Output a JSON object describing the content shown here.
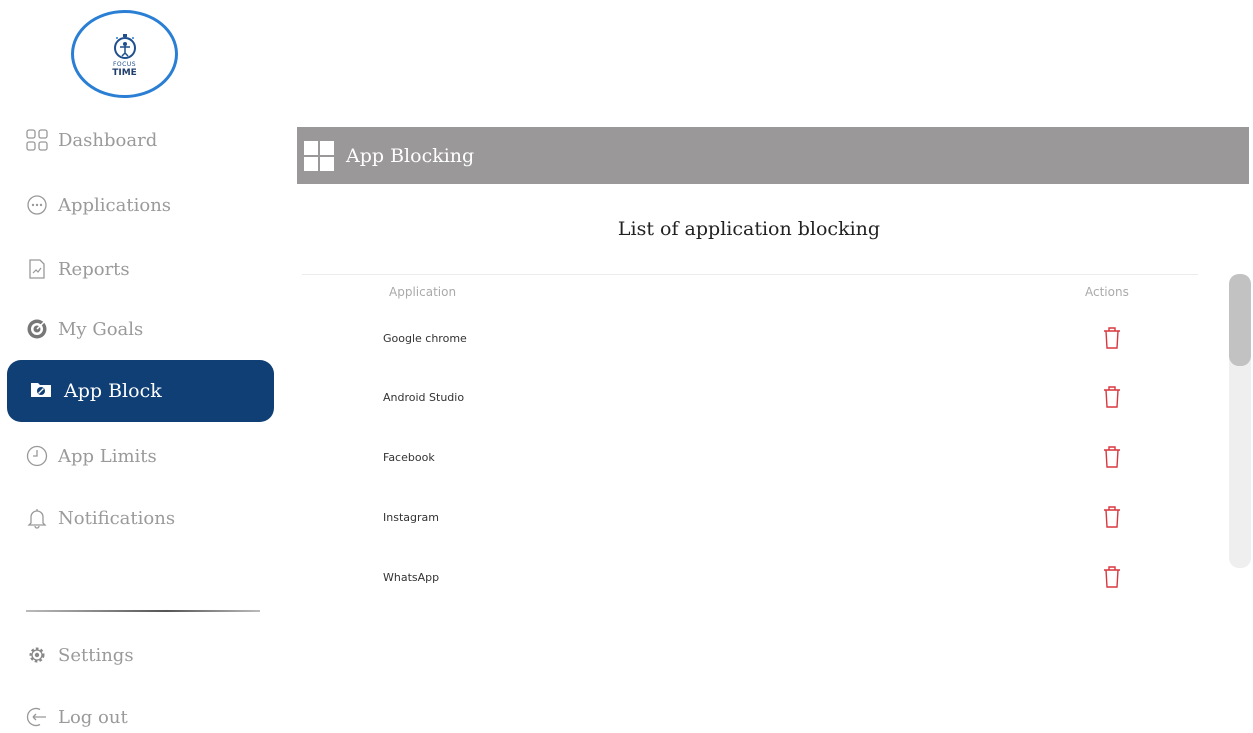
{
  "brand": {
    "small": "FOCUS",
    "big": "TIME"
  },
  "sidebar": {
    "items": [
      {
        "label": "Dashboard",
        "icon": "dashboard-grid-icon"
      },
      {
        "label": "Applications",
        "icon": "applications-icon"
      },
      {
        "label": "Reports",
        "icon": "reports-icon"
      },
      {
        "label": "My Goals",
        "icon": "target-icon"
      },
      {
        "label": "App Block",
        "icon": "app-block-icon",
        "active": true
      },
      {
        "label": "App Limits",
        "icon": "clock-icon"
      },
      {
        "label": "Notifications",
        "icon": "bell-icon"
      }
    ],
    "bottom": [
      {
        "label": "Settings",
        "icon": "gear-icon"
      },
      {
        "label": "Log out",
        "icon": "logout-icon"
      }
    ]
  },
  "header": {
    "title": "App Blocking",
    "icon": "windows-grid-icon"
  },
  "main": {
    "list_title": "List of application blocking",
    "columns": {
      "application": "Application",
      "actions": "Actions"
    },
    "rows": [
      {
        "name": "Google chrome"
      },
      {
        "name": "Android Studio"
      },
      {
        "name": "Facebook"
      },
      {
        "name": "Instagram"
      },
      {
        "name": "WhatsApp"
      }
    ]
  },
  "colors": {
    "active_nav": "#0f3f75",
    "header_bar": "#9a9898",
    "delete_icon": "#d9363e",
    "logo_ring": "#2a7fd4"
  }
}
